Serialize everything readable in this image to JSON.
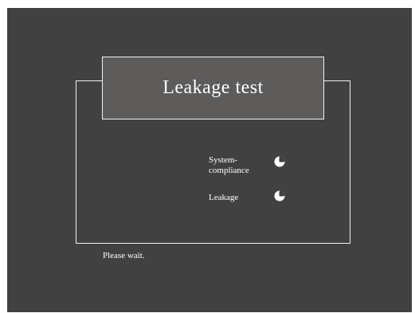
{
  "dialog": {
    "title": "Leakage test",
    "steps": [
      {
        "label_line1": "System-",
        "label_line2": "compliance",
        "icon": "clock-icon",
        "status": "in-progress"
      },
      {
        "label_line1": "Leakage",
        "icon": "clock-icon",
        "status": "in-progress"
      }
    ],
    "footer_message": "Please wait."
  },
  "colors": {
    "background": "#414141",
    "title_background": "#5e5b5b",
    "border": "#f2f2f2",
    "text": "#ffffff"
  }
}
